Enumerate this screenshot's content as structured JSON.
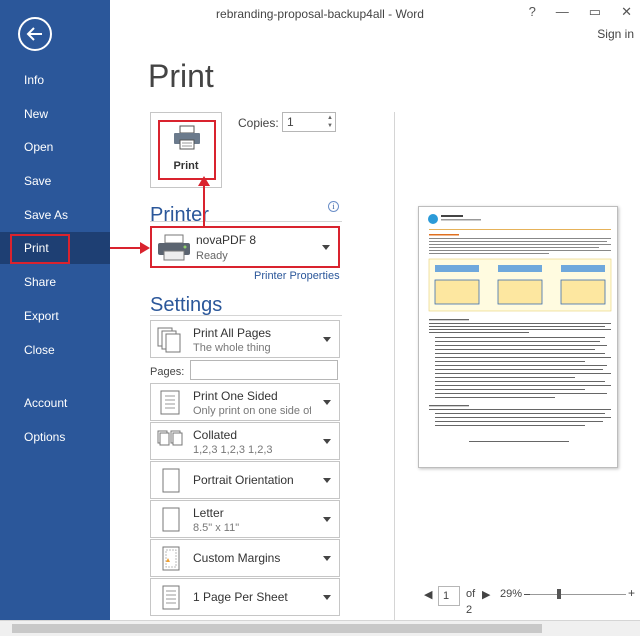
{
  "window": {
    "title": "rebranding-proposal-backup4all - Word",
    "help": "?",
    "minimize": "—",
    "restore": "▭",
    "close": "✕",
    "signin": "Sign in"
  },
  "sidebar": {
    "items": [
      {
        "label": "Info"
      },
      {
        "label": "New"
      },
      {
        "label": "Open"
      },
      {
        "label": "Save"
      },
      {
        "label": "Save As"
      },
      {
        "label": "Print"
      },
      {
        "label": "Share"
      },
      {
        "label": "Export"
      },
      {
        "label": "Close"
      },
      {
        "label": "Account"
      },
      {
        "label": "Options"
      }
    ]
  },
  "print": {
    "heading": "Print",
    "button_label": "Print",
    "copies_label": "Copies:",
    "copies_value": "1"
  },
  "printer": {
    "heading": "Printer",
    "name": "novaPDF 8",
    "status": "Ready",
    "properties_link": "Printer Properties"
  },
  "settings": {
    "heading": "Settings",
    "pages_label": "Pages:",
    "items": [
      {
        "line1": "Print All Pages",
        "line2": "The whole thing"
      },
      {
        "line1": "Print One Sided",
        "line2": "Only print on one side of..."
      },
      {
        "line1": "Collated",
        "line2": "1,2,3    1,2,3    1,2,3"
      },
      {
        "line1": "Portrait Orientation",
        "line2": ""
      },
      {
        "line1": "Letter",
        "line2": "8.5\" x 11\""
      },
      {
        "line1": "Custom Margins",
        "line2": ""
      },
      {
        "line1": "1 Page Per Sheet",
        "line2": ""
      }
    ]
  },
  "preview": {
    "page_current": "1",
    "page_of": "of",
    "page_total": "2",
    "zoom": "29%"
  },
  "colors": {
    "sidebar": "#2b579a",
    "accent": "#2b579a",
    "highlight": "#d9232e"
  }
}
